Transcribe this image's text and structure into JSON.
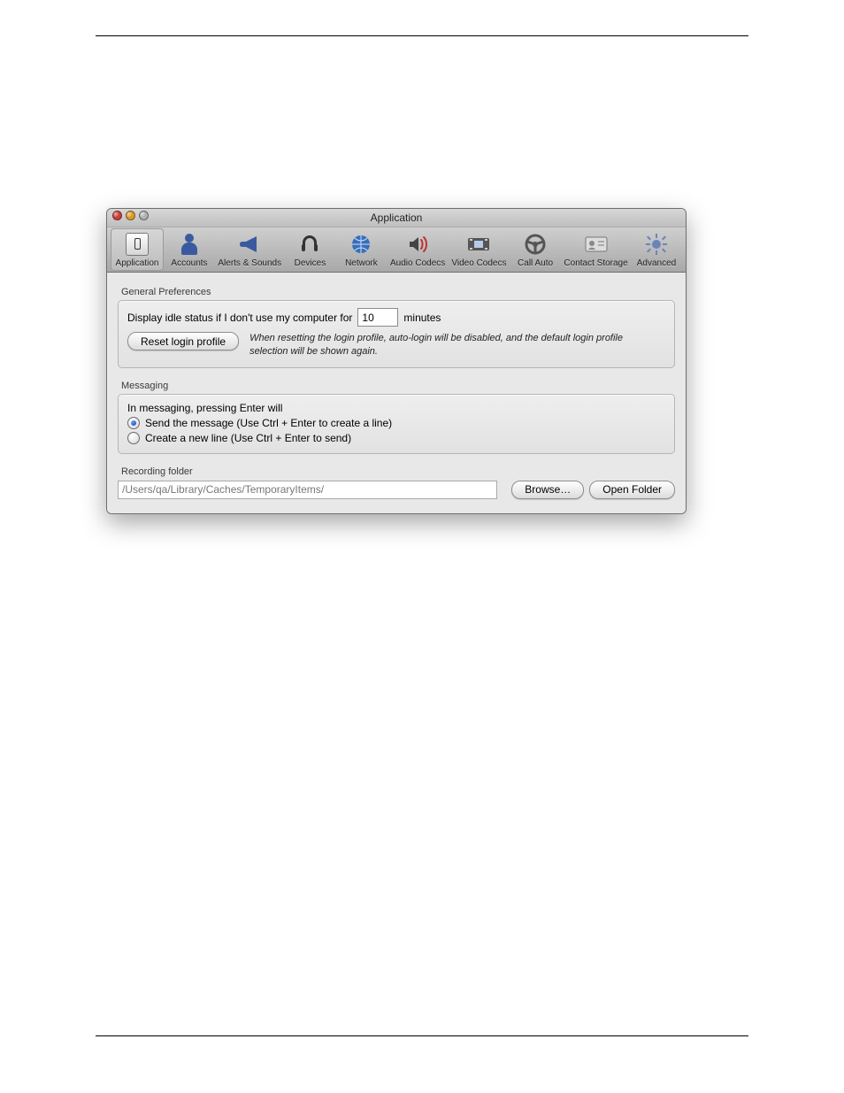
{
  "window": {
    "title": "Application"
  },
  "toolbar": {
    "items": [
      {
        "label": "Application",
        "icon": "application-icon",
        "selected": true
      },
      {
        "label": "Accounts",
        "icon": "accounts-icon"
      },
      {
        "label": "Alerts & Sounds",
        "icon": "alerts-icon"
      },
      {
        "label": "Devices",
        "icon": "devices-icon"
      },
      {
        "label": "Network",
        "icon": "network-icon"
      },
      {
        "label": "Audio Codecs",
        "icon": "audio-codecs-icon"
      },
      {
        "label": "Video Codecs",
        "icon": "video-codecs-icon"
      },
      {
        "label": "Call Auto",
        "icon": "call-auto-icon"
      },
      {
        "label": "Contact Storage",
        "icon": "contact-storage-icon"
      },
      {
        "label": "Advanced",
        "icon": "advanced-icon"
      }
    ]
  },
  "general": {
    "section_label": "General Preferences",
    "idle_prefix": "Display idle status if I don't use my computer for",
    "idle_value": "10",
    "idle_suffix": "minutes",
    "reset_button": "Reset login profile",
    "reset_help": "When resetting the login profile, auto-login will be disabled, and the default login profile selection will be shown again."
  },
  "messaging": {
    "section_label": "Messaging",
    "prompt": "In messaging, pressing Enter will",
    "options": [
      {
        "label": "Send the message (Use Ctrl + Enter to create a line)",
        "checked": true
      },
      {
        "label": "Create a new line (Use Ctrl + Enter to send)",
        "checked": false
      }
    ]
  },
  "recording": {
    "section_label": "Recording folder",
    "path": "/Users/qa/Library/Caches/TemporaryItems/",
    "browse_button": "Browse…",
    "open_button": "Open Folder"
  }
}
